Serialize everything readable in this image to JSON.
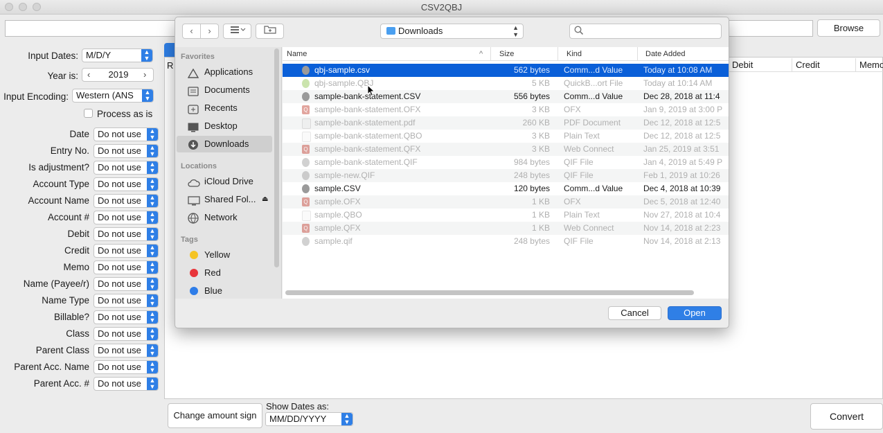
{
  "window": {
    "title": "CSV2QBJ"
  },
  "top_bar": {
    "browse_label": "Browse"
  },
  "settings": {
    "input_dates_label": "Input Dates:",
    "input_dates_value": "M/D/Y",
    "year_label": "Year is:",
    "year_value": "2019",
    "encoding_label": "Input Encoding:",
    "encoding_value": "Western (ANS",
    "process_as_is_label": "Process as is",
    "mappings": [
      {
        "label": "Date",
        "value": "Do not use"
      },
      {
        "label": "Entry No.",
        "value": "Do not use"
      },
      {
        "label": "Is adjustment?",
        "value": "Do not use"
      },
      {
        "label": "Account Type",
        "value": "Do not use"
      },
      {
        "label": "Account Name",
        "value": "Do not use"
      },
      {
        "label": "Account #",
        "value": "Do not use"
      },
      {
        "label": "Debit",
        "value": "Do not use"
      },
      {
        "label": "Credit",
        "value": "Do not use"
      },
      {
        "label": "Memo",
        "value": "Do not use"
      },
      {
        "label": "Name (Payee/r)",
        "value": "Do not use"
      },
      {
        "label": "Name Type",
        "value": "Do not use"
      },
      {
        "label": "Billable?",
        "value": "Do not use"
      },
      {
        "label": "Class",
        "value": "Do not use"
      },
      {
        "label": "Parent Class",
        "value": "Do not use"
      },
      {
        "label": "Parent Acc. Name",
        "value": "Do not use"
      },
      {
        "label": "Parent Acc. #",
        "value": "Do not use"
      }
    ]
  },
  "table": {
    "partial_header_left": "R",
    "columns": [
      "Debit",
      "Credit",
      "Memo"
    ]
  },
  "bottom": {
    "change_sign_label": "Change amount sign",
    "show_dates_label": "Show Dates as:",
    "show_dates_value": "MM/DD/YYYY",
    "convert_label": "Convert"
  },
  "dialog": {
    "location": "Downloads",
    "search_placeholder": "",
    "sidebar": {
      "favorites_header": "Favorites",
      "favorites": [
        {
          "label": "Applications",
          "icon": "applications-icon"
        },
        {
          "label": "Documents",
          "icon": "documents-icon"
        },
        {
          "label": "Recents",
          "icon": "recents-icon"
        },
        {
          "label": "Desktop",
          "icon": "desktop-icon"
        },
        {
          "label": "Downloads",
          "icon": "downloads-icon",
          "selected": true
        }
      ],
      "locations_header": "Locations",
      "locations": [
        {
          "label": "iCloud Drive",
          "icon": "cloud-icon"
        },
        {
          "label": "Shared Fol...",
          "icon": "shared-folder-icon"
        },
        {
          "label": "Network",
          "icon": "network-icon"
        }
      ],
      "tags_header": "Tags",
      "tags": [
        {
          "label": "Yellow",
          "color": "#f5c423"
        },
        {
          "label": "Red",
          "color": "#e8353a"
        },
        {
          "label": "Blue",
          "color": "#2e7de8"
        }
      ]
    },
    "columns": {
      "name": "Name",
      "size": "Size",
      "kind": "Kind",
      "date": "Date Added"
    },
    "files": [
      {
        "name": "qbj-sample.csv",
        "size": "562 bytes",
        "kind": "Comm...d Value",
        "date": "Today at 10:08 AM",
        "state": "selected",
        "icon": "csv"
      },
      {
        "name": "qbj-sample.QBJ",
        "size": "5 KB",
        "kind": "QuickB...ort File",
        "date": "Today at 10:14 AM",
        "state": "disabled",
        "icon": "qbj"
      },
      {
        "name": "sample-bank-statement.CSV",
        "size": "556 bytes",
        "kind": "Comm...d Value",
        "date": "Dec 28, 2018 at 11:4",
        "state": "enabled",
        "icon": "csv"
      },
      {
        "name": "sample-bank-statement.OFX",
        "size": "3 KB",
        "kind": "OFX",
        "date": "Jan 9, 2019 at 3:00 P",
        "state": "disabled",
        "icon": "q"
      },
      {
        "name": "sample-bank-statement.pdf",
        "size": "260 KB",
        "kind": "PDF Document",
        "date": "Dec 12, 2018 at 12:5",
        "state": "disabled",
        "icon": "pdf"
      },
      {
        "name": "sample-bank-statement.QBO",
        "size": "3 KB",
        "kind": "Plain Text",
        "date": "Dec 12, 2018 at 12:5",
        "state": "disabled",
        "icon": "doc"
      },
      {
        "name": "sample-bank-statement.QFX",
        "size": "3 KB",
        "kind": "Web Connect",
        "date": "Jan 25, 2019 at 3:51",
        "state": "disabled",
        "icon": "q"
      },
      {
        "name": "sample-bank-statement.QIF",
        "size": "984 bytes",
        "kind": "QIF File",
        "date": "Jan 4, 2019 at 5:49 P",
        "state": "disabled",
        "icon": "csv"
      },
      {
        "name": "sample-new.QIF",
        "size": "248 bytes",
        "kind": "QIF File",
        "date": "Feb 1, 2019 at 10:26",
        "state": "disabled",
        "icon": "csv"
      },
      {
        "name": "sample.CSV",
        "size": "120 bytes",
        "kind": "Comm...d Value",
        "date": "Dec 4, 2018 at 10:39",
        "state": "enabled",
        "icon": "csv"
      },
      {
        "name": "sample.OFX",
        "size": "1 KB",
        "kind": "OFX",
        "date": "Dec 5, 2018 at 12:40",
        "state": "disabled",
        "icon": "q"
      },
      {
        "name": "sample.QBO",
        "size": "1 KB",
        "kind": "Plain Text",
        "date": "Nov 27, 2018 at 10:4",
        "state": "disabled",
        "icon": "doc"
      },
      {
        "name": "sample.QFX",
        "size": "1 KB",
        "kind": "Web Connect",
        "date": "Nov 14, 2018 at 2:23",
        "state": "disabled",
        "icon": "q"
      },
      {
        "name": "sample.qif",
        "size": "248 bytes",
        "kind": "QIF File",
        "date": "Nov 14, 2018 at 2:13",
        "state": "disabled",
        "icon": "csv"
      }
    ],
    "cancel_label": "Cancel",
    "open_label": "Open"
  },
  "colors": {
    "accent": "#2f7fe6",
    "selection": "#0a5fd8"
  }
}
